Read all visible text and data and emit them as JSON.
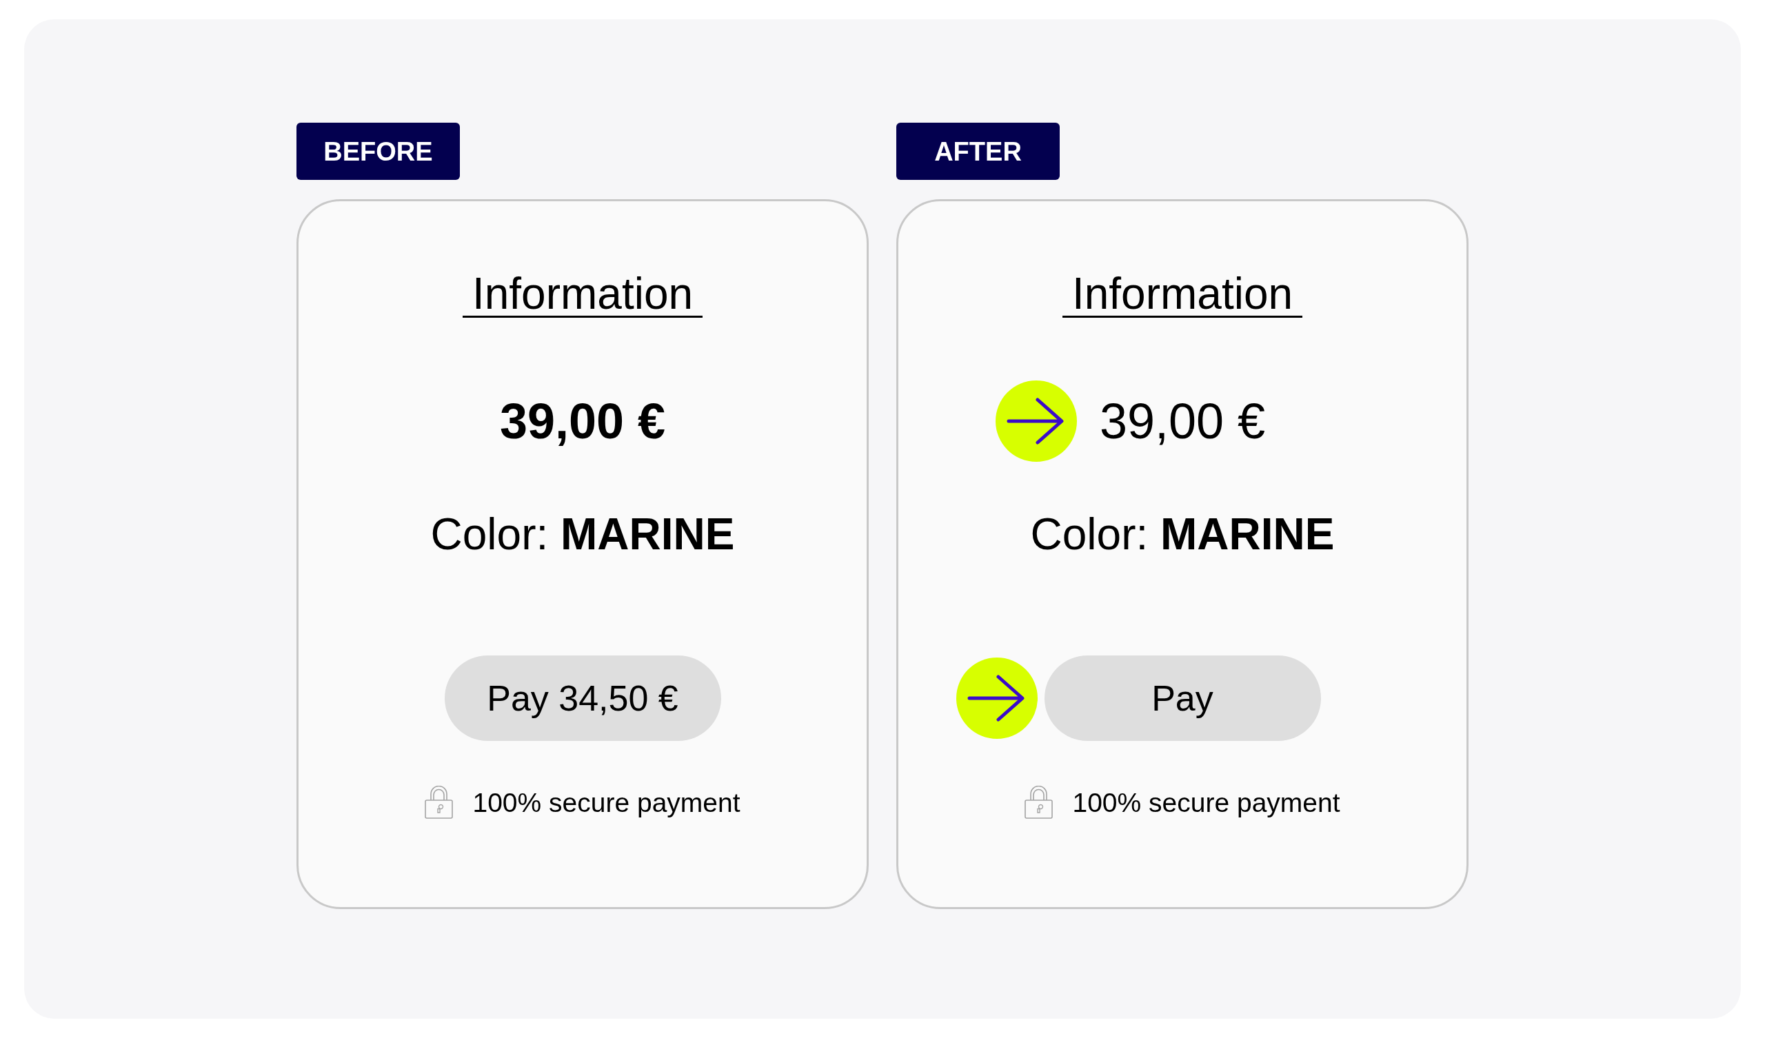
{
  "panels": [
    {
      "tag": "BEFORE",
      "card": {
        "title": "Information",
        "price": {
          "text": "39,00 €",
          "bold": true,
          "marked": false
        },
        "color_line": "Color: **MARINE**",
        "pay_button": {
          "label": "Pay 34,50 €",
          "marked": false
        },
        "secure_note": "100% secure payment"
      }
    },
    {
      "tag": "AFTER",
      "card": {
        "title": "Information",
        "price": {
          "text": "39,00 €",
          "bold": false,
          "marked": true
        },
        "color_line": "Color: **MARINE**",
        "pay_button": {
          "label": "Pay",
          "marked": true
        },
        "secure_note": "100% secure payment"
      }
    }
  ]
}
